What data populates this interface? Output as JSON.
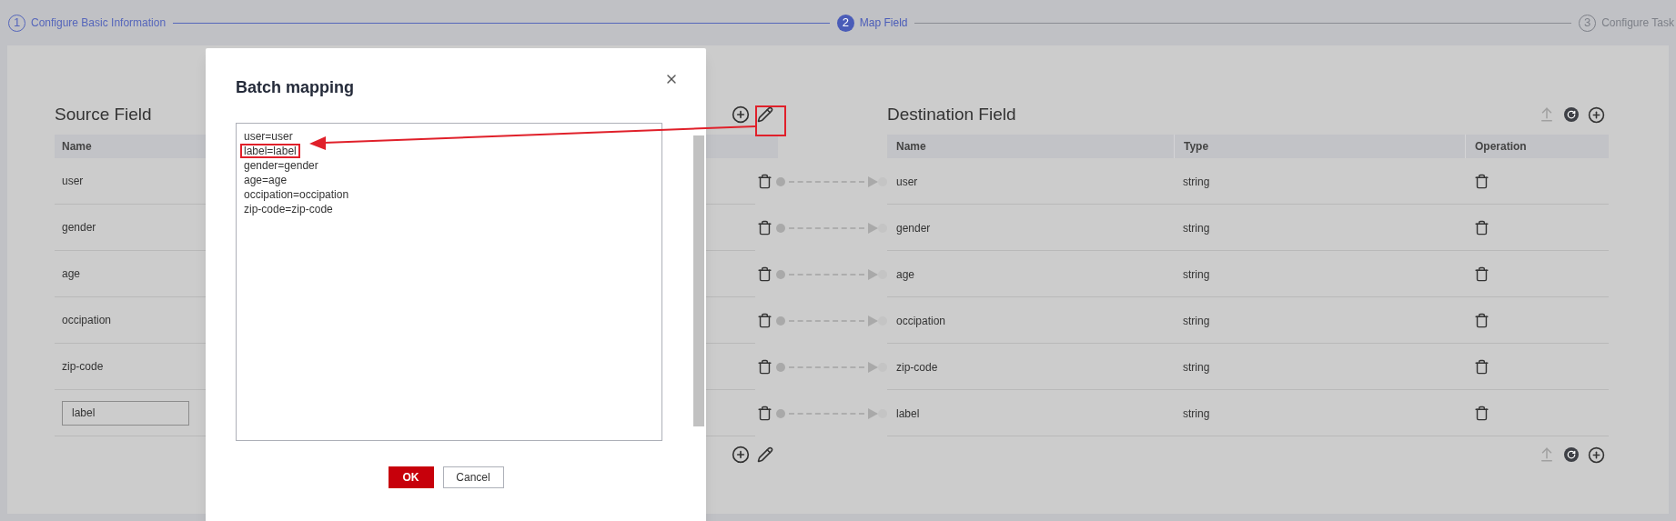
{
  "steps": [
    {
      "number": "1",
      "label": "Configure Basic Information",
      "selected": false,
      "completed": true
    },
    {
      "number": "2",
      "label": "Map Field",
      "selected": true,
      "completed": false
    },
    {
      "number": "3",
      "label": "Configure Task",
      "selected": false,
      "completed": false
    }
  ],
  "source": {
    "title": "Source Field",
    "header": "Name",
    "rows": [
      {
        "kind": "text",
        "name": "user"
      },
      {
        "kind": "text",
        "name": "gender"
      },
      {
        "kind": "text",
        "name": "age"
      },
      {
        "kind": "text",
        "name": "occipation"
      },
      {
        "kind": "text",
        "name": "zip-code"
      },
      {
        "kind": "input",
        "name": "label"
      }
    ],
    "pencil_highlighted": true
  },
  "destination": {
    "title": "Destination Field",
    "columns": [
      "Name",
      "Type",
      "Operation"
    ],
    "rows": [
      {
        "name": "user",
        "type": "string"
      },
      {
        "name": "gender",
        "type": "string"
      },
      {
        "name": "age",
        "type": "string"
      },
      {
        "name": "occipation",
        "type": "string"
      },
      {
        "name": "zip-code",
        "type": "string"
      },
      {
        "name": "label",
        "type": "string"
      }
    ]
  },
  "dialog": {
    "title": "Batch mapping",
    "lines": [
      {
        "text": "user=user",
        "highlighted": false
      },
      {
        "text": "label=label",
        "highlighted": true
      },
      {
        "text": "gender=gender",
        "highlighted": false
      },
      {
        "text": "age=age",
        "highlighted": false
      },
      {
        "text": "occipation=occipation",
        "highlighted": false
      },
      {
        "text": "zip-code=zip-code",
        "highlighted": false
      }
    ],
    "ok": "OK",
    "cancel": "Cancel"
  },
  "annotation_arrow": true
}
